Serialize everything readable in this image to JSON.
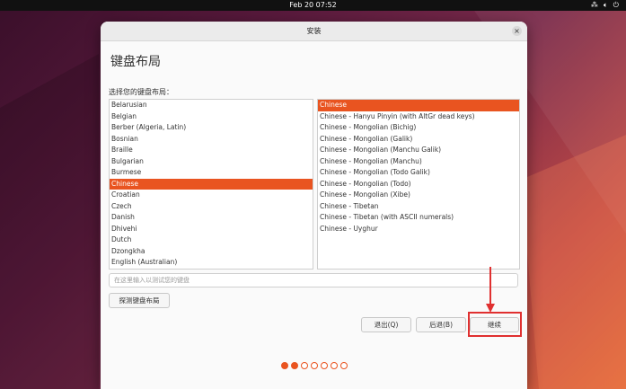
{
  "topbar": {
    "clock": "Feb 20  07:52",
    "icons": [
      "network-icon",
      "volume-icon",
      "power-icon"
    ]
  },
  "window": {
    "title": "安装",
    "heading": "键盘布局",
    "list_label": "选择您的键盘布局："
  },
  "layouts": [
    {
      "label": "Belarusian",
      "selected": false
    },
    {
      "label": "Belgian",
      "selected": false
    },
    {
      "label": "Berber (Algeria, Latin)",
      "selected": false
    },
    {
      "label": "Bosnian",
      "selected": false
    },
    {
      "label": "Braille",
      "selected": false
    },
    {
      "label": "Bulgarian",
      "selected": false
    },
    {
      "label": "Burmese",
      "selected": false
    },
    {
      "label": "Chinese",
      "selected": true
    },
    {
      "label": "Croatian",
      "selected": false
    },
    {
      "label": "Czech",
      "selected": false
    },
    {
      "label": "Danish",
      "selected": false
    },
    {
      "label": "Dhivehi",
      "selected": false
    },
    {
      "label": "Dutch",
      "selected": false
    },
    {
      "label": "Dzongkha",
      "selected": false
    },
    {
      "label": "English (Australian)",
      "selected": false
    }
  ],
  "variants": [
    {
      "label": "Chinese",
      "selected": true
    },
    {
      "label": "Chinese - Hanyu Pinyin (with AltGr dead keys)",
      "selected": false
    },
    {
      "label": "Chinese - Mongolian (Bichig)",
      "selected": false
    },
    {
      "label": "Chinese - Mongolian (Galik)",
      "selected": false
    },
    {
      "label": "Chinese - Mongolian (Manchu Galik)",
      "selected": false
    },
    {
      "label": "Chinese - Mongolian (Manchu)",
      "selected": false
    },
    {
      "label": "Chinese - Mongolian (Todo Galik)",
      "selected": false
    },
    {
      "label": "Chinese - Mongolian (Todo)",
      "selected": false
    },
    {
      "label": "Chinese - Mongolian (Xibe)",
      "selected": false
    },
    {
      "label": "Chinese - Tibetan",
      "selected": false
    },
    {
      "label": "Chinese - Tibetan (with ASCII numerals)",
      "selected": false
    },
    {
      "label": "Chinese - Uyghur",
      "selected": false
    }
  ],
  "test_input": {
    "placeholder": "在这里输入以测试您的键盘",
    "value": ""
  },
  "buttons": {
    "detect": "探测键盘布局",
    "quit": "退出(Q)",
    "back": "后退(B)",
    "continue": "继续"
  },
  "progress": {
    "total_steps": 7,
    "current_step": 2
  },
  "colors": {
    "accent": "#e95420",
    "annotation": "#e03030"
  }
}
